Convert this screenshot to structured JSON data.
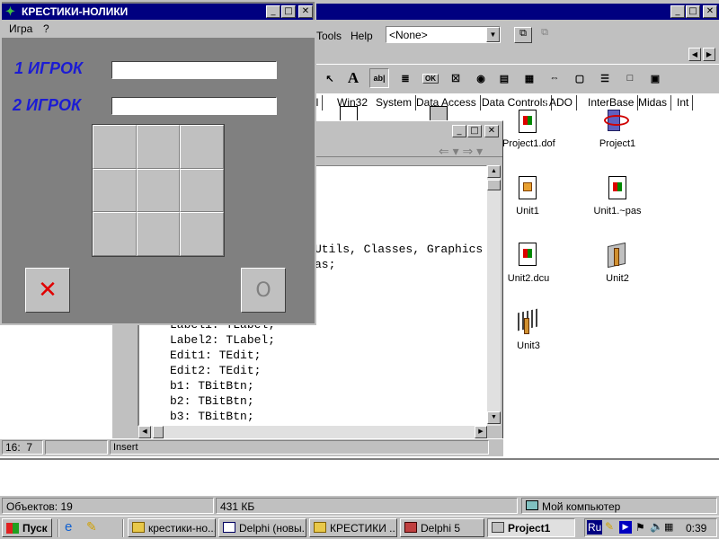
{
  "game": {
    "title": "КРЕСТИКИ-НОЛИКИ",
    "menu": [
      "Игра",
      "?"
    ],
    "player1_label": "1 ИГРОК",
    "player2_label": "2 ИГРОК",
    "player1_value": "",
    "player2_value": "",
    "cross_glyph": "✕",
    "nought_glyph": "O",
    "cross_color": "#e00000"
  },
  "delphi": {
    "menu": [
      "Tools",
      "Help"
    ],
    "combo_value": "<None>",
    "palette_tabs": [
      "al",
      "Win32",
      "System",
      "Data Access",
      "Data Controls",
      "ADO",
      "InterBase",
      "Midas",
      "Int"
    ],
    "palette_icons": [
      "arrow-icon",
      "label-icon",
      "edit-icon",
      "memo-icon",
      "button-icon",
      "checkbox-icon",
      "radiobutton-icon",
      "listbox-icon",
      "combobox-icon",
      "scrollbar-icon",
      "groupbox-icon",
      "radiogroup-icon",
      "panel-icon",
      "actionlist-icon"
    ]
  },
  "files": [
    {
      "label": "Project1.dof",
      "icon": "dof-file-icon"
    },
    {
      "label": "Project1",
      "icon": "delphi-project-icon"
    },
    {
      "label": "Unit1",
      "icon": "unit-file-icon"
    },
    {
      "label": "Unit1.~pas",
      "icon": "pas-backup-icon"
    },
    {
      "label": "Unit2.dcu",
      "icon": "dcu-file-icon"
    },
    {
      "label": "Unit2",
      "icon": "pascal-unit-icon"
    },
    {
      "label": "Unit3",
      "icon": "pascal-unit-icon"
    }
  ],
  "code": {
    "lines": [
      "Utils, Classes, Graphics",
      "as;",
      "Label1: TLabel;",
      "Label2: TLabel;",
      "Edit1: TEdit;",
      "Edit2: TEdit;",
      "b1: TBitBtn;",
      "b2: TBitBtn;",
      "b3: TBitBtn;"
    ],
    "cursor_pos": "16:  7",
    "mode": "Insert"
  },
  "status": {
    "objects": "Объектов: 19",
    "size": "431 КБ",
    "location": "Мой компьютер"
  },
  "taskbar": {
    "start_label": "Пуск",
    "buttons": [
      "крестики-но...",
      "Delphi (новы...",
      "КРЕСТИКИ ...",
      "Delphi 5",
      "Project1"
    ],
    "lang": "Ru",
    "clock": "0:39"
  }
}
